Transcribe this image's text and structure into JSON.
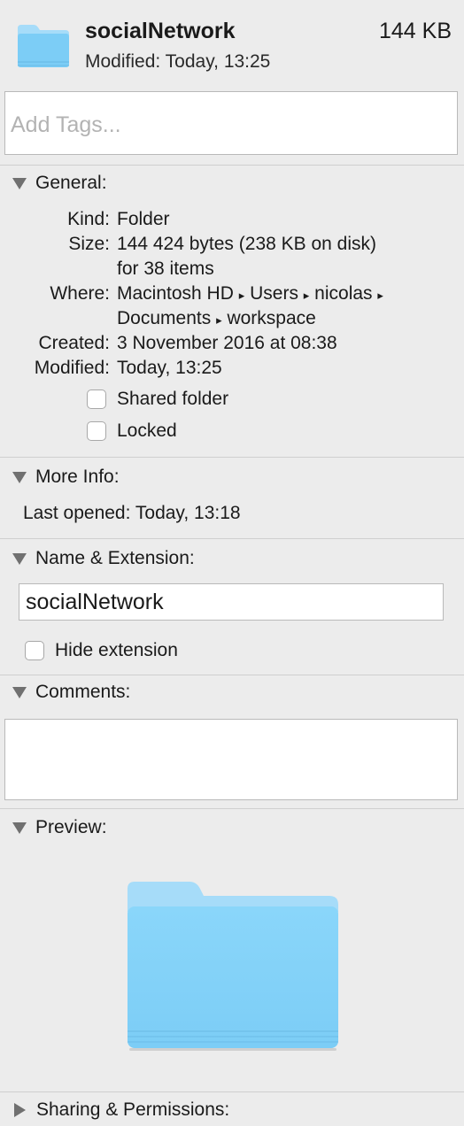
{
  "header": {
    "name": "socialNetwork",
    "size": "144 KB",
    "modified": "Modified: Today, 13:25",
    "icon": "folder-icon"
  },
  "tags": {
    "placeholder": "Add Tags..."
  },
  "general": {
    "title": "General:",
    "kind_label": "Kind:",
    "kind_value": "Folder",
    "size_label": "Size:",
    "size_value_1": "144 424 bytes (238 KB on disk)",
    "size_value_2": "for 38 items",
    "where_label": "Where:",
    "where_path_1": [
      "Macintosh HD",
      "Users",
      "nicolas"
    ],
    "where_path_2": [
      "Documents",
      "workspace"
    ],
    "path_separator": "▸",
    "created_label": "Created:",
    "created_value": "3 November 2016 at 08:38",
    "modified_label": "Modified:",
    "modified_value": "Today, 13:25",
    "shared_folder_label": "Shared folder",
    "shared_folder_checked": false,
    "locked_label": "Locked",
    "locked_checked": false
  },
  "more_info": {
    "title": "More Info:",
    "last_opened": "Last opened: Today, 13:18"
  },
  "name_extension": {
    "title": "Name & Extension:",
    "name_value": "socialNetwork",
    "hide_extension_label": "Hide extension",
    "hide_extension_checked": false
  },
  "comments": {
    "title": "Comments:",
    "value": ""
  },
  "preview": {
    "title": "Preview:",
    "icon": "folder-icon"
  },
  "sharing": {
    "title": "Sharing & Permissions:",
    "expanded": false
  },
  "colors": {
    "background": "#ececec",
    "folder_light": "#a6dcf9",
    "folder_main": "#7ccdf6",
    "folder_shade": "#6bbbe6",
    "triangle": "#707070"
  }
}
